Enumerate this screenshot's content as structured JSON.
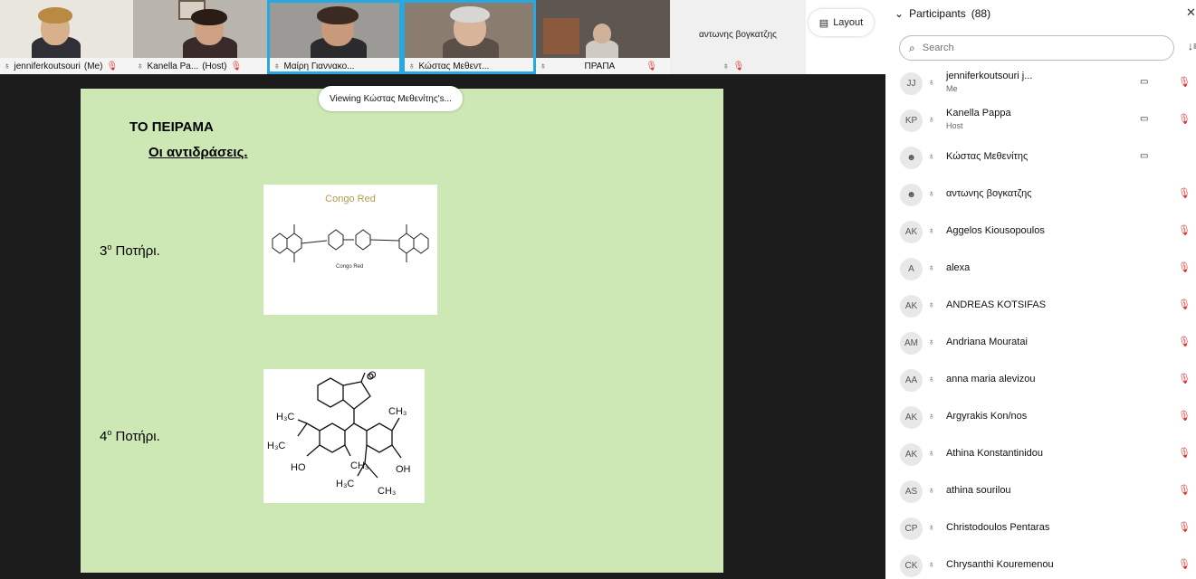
{
  "video_tiles": [
    {
      "name": "jenniferkoutsouri",
      "tag": "(Me)"
    },
    {
      "name": "Kanella Pa...",
      "tag": "(Host)"
    },
    {
      "name": "Μαίρη Γιαννακο..."
    },
    {
      "name": "Κώστας Μεθεντ..."
    },
    {
      "name": "ΠΡΑΠΑ"
    },
    {
      "name": "αντωνης βογκατζης"
    }
  ],
  "layout_label": "Layout",
  "viewing_label": "Viewing Κώστας Μεθενίτης's...",
  "slide": {
    "title": "ΤΟ ΠΕΙΡΑΜΑ",
    "subtitle": "Οι αντιδράσεις.",
    "cup3": "3",
    "cup3_sup": "ο",
    "cup3_text": "Ποτήρι.",
    "cup4": "4",
    "cup4_sup": "ο",
    "cup4_text": "Ποτήρι.",
    "mol1_title": "Congo Red",
    "mol1_caption": "Congo Red"
  },
  "participants": {
    "title": "Participants",
    "count": "(88)",
    "search_placeholder": "Search",
    "list": [
      {
        "initials": "JJ",
        "name": "jenniferkoutsouri j...",
        "role": "Me",
        "camera": true
      },
      {
        "initials": "KP",
        "name": "Kanella Pappa",
        "role": "Host",
        "camera": true
      },
      {
        "initials": "",
        "name": "Κώστας Μεθενίτης",
        "role": "",
        "camera": true
      },
      {
        "initials": "",
        "name": "αντωνης βογκατζης",
        "role": "",
        "camera": false
      },
      {
        "initials": "AK",
        "name": "Aggelos Kiousopoulos",
        "role": "",
        "camera": false
      },
      {
        "initials": "A",
        "name": "alexa",
        "role": "",
        "camera": false
      },
      {
        "initials": "AK",
        "name": "ANDREAS KOTSIFAS",
        "role": "",
        "camera": false
      },
      {
        "initials": "AM",
        "name": "Andriana Mouratai",
        "role": "",
        "camera": false
      },
      {
        "initials": "AA",
        "name": "anna maria alevizou",
        "role": "",
        "camera": false
      },
      {
        "initials": "AK",
        "name": "Argyrakis Kon/nos",
        "role": "",
        "camera": false
      },
      {
        "initials": "AK",
        "name": "Athina Konstantinidou",
        "role": "",
        "camera": false
      },
      {
        "initials": "AS",
        "name": "athina sourilou",
        "role": "",
        "camera": false
      },
      {
        "initials": "CP",
        "name": "Christodoulos Pentaras",
        "role": "",
        "camera": false
      },
      {
        "initials": "CK",
        "name": "Chrysanthi Kouremenou",
        "role": "",
        "camera": false
      }
    ]
  },
  "colors": {
    "accent": "#28a8e0",
    "mute": "#dd3333",
    "slide_bg": "#cde8b4"
  }
}
